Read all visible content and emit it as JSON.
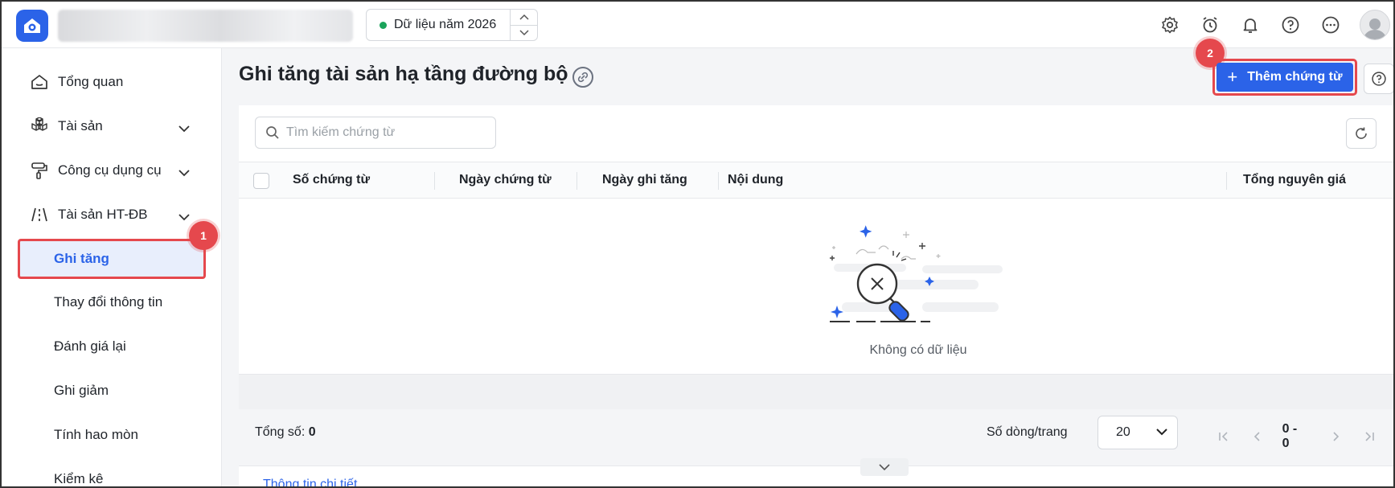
{
  "header": {
    "year_status_color": "#1aa35a",
    "year_label": "Dữ liệu năm 2026",
    "icons": [
      "settings-icon",
      "alarm-icon",
      "bell-icon",
      "help-icon",
      "more-icon"
    ]
  },
  "sidebar": {
    "items": [
      {
        "label": "Tổng quan",
        "icon": "home-icon"
      },
      {
        "label": "Tài sản",
        "icon": "boxes-icon"
      },
      {
        "label": "Công cụ dụng cụ",
        "icon": "paint-roller-icon"
      },
      {
        "label": "Tài sản HT-ĐB",
        "icon": "road-icon"
      }
    ],
    "subitems": [
      {
        "label": "Ghi tăng"
      },
      {
        "label": "Thay đổi thông tin"
      },
      {
        "label": "Đánh giá lại"
      },
      {
        "label": "Ghi giảm"
      },
      {
        "label": "Tính hao mòn"
      },
      {
        "label": "Kiểm kê"
      }
    ]
  },
  "badges": {
    "step1": "1",
    "step2": "2"
  },
  "main": {
    "title": "Ghi tăng tài sản hạ tầng đường bộ",
    "add_button": "Thêm chứng từ",
    "search_placeholder": "Tìm kiếm chứng từ",
    "columns": [
      "Số chứng từ",
      "Ngày chứng từ",
      "Ngày ghi tăng",
      "Nội dung",
      "Tổng nguyên giá"
    ],
    "empty_text": "Không có dữ liệu"
  },
  "footer": {
    "total_label": "Tổng số:",
    "total_value": "0",
    "rows_label": "Số dòng/trang",
    "rows_value": "20",
    "range": "0 - 0"
  },
  "detail": {
    "tab_label": "Thông tin chi tiết"
  },
  "colors": {
    "accent": "#2b63e8",
    "highlight": "#e5484d"
  }
}
